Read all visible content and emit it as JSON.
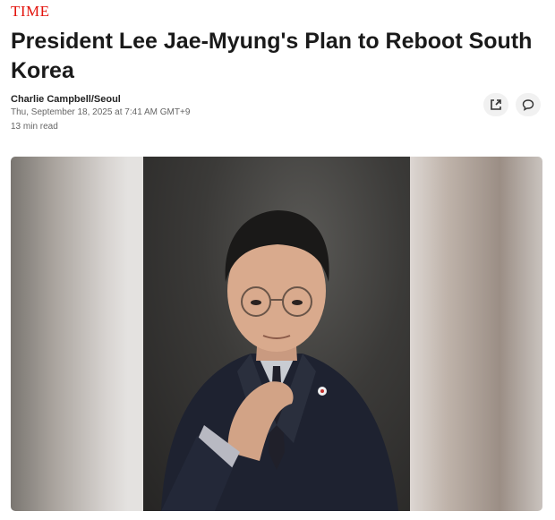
{
  "header": {
    "brand": "TIME"
  },
  "article": {
    "headline": "President Lee Jae-Myung's Plan to Reboot South Korea",
    "author": "Charlie Campbell/Seoul",
    "date": "Thu, September 18, 2025 at 7:41 AM GMT+9",
    "read_time": "13 min read"
  },
  "actions": {
    "share_icon": "share-icon",
    "comment_icon": "comment-icon"
  },
  "colors": {
    "brand": "#e3120b",
    "text": "#1a1a1a",
    "meta": "#666666"
  }
}
